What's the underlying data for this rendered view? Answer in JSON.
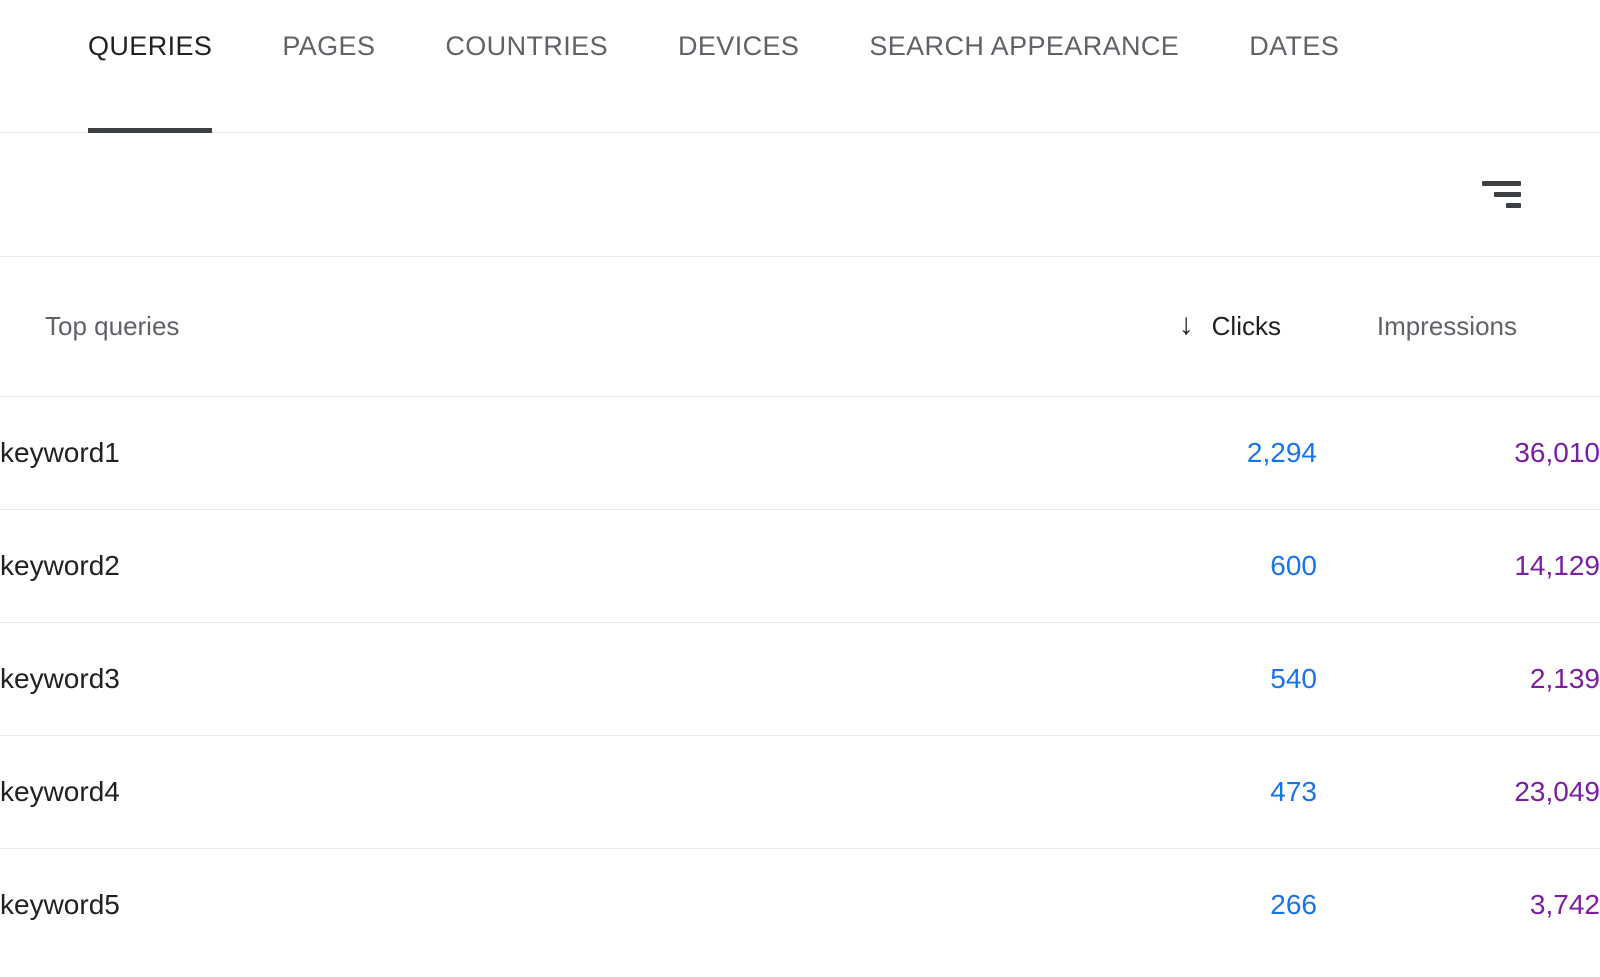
{
  "tabs": [
    {
      "label": "QUERIES",
      "active": true
    },
    {
      "label": "PAGES",
      "active": false
    },
    {
      "label": "COUNTRIES",
      "active": false
    },
    {
      "label": "DEVICES",
      "active": false
    },
    {
      "label": "SEARCH APPEARANCE",
      "active": false
    },
    {
      "label": "DATES",
      "active": false
    }
  ],
  "toolbar": {
    "filter_icon": "filter-icon"
  },
  "table": {
    "columns": {
      "query": "Top queries",
      "clicks": "Clicks",
      "impressions": "Impressions"
    },
    "sort": {
      "column": "Clicks",
      "direction": "descending",
      "arrow_glyph": "↓"
    },
    "rows": [
      {
        "query": "keyword1",
        "clicks": "2,294",
        "impressions": "36,010"
      },
      {
        "query": "keyword2",
        "clicks": "600",
        "impressions": "14,129"
      },
      {
        "query": "keyword3",
        "clicks": "540",
        "impressions": "2,139"
      },
      {
        "query": "keyword4",
        "clicks": "473",
        "impressions": "23,049"
      },
      {
        "query": "keyword5",
        "clicks": "266",
        "impressions": "3,742"
      }
    ]
  },
  "colors": {
    "clicks": "#1a73e8",
    "impressions": "#7b1fa2",
    "text_primary": "#202124",
    "text_secondary": "#5f6368",
    "divider": "#e8eaed",
    "active_tab_underline": "#3c4043"
  }
}
